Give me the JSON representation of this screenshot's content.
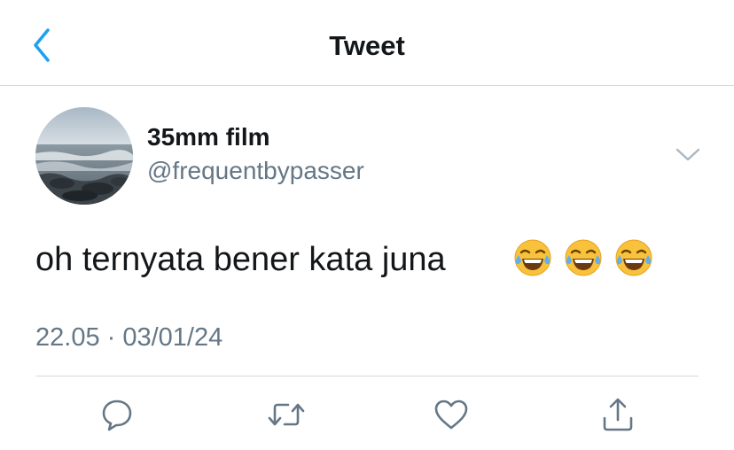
{
  "header": {
    "title": "Tweet",
    "back_icon": "chevron-left-icon",
    "accent_color": "#1da1f2"
  },
  "author": {
    "display_name": "35mm film",
    "handle": "@frequentbypasser",
    "avatar": "beach-photo-avatar"
  },
  "tweet": {
    "text": "oh ternyata bener kata juna",
    "emojis": [
      "😂",
      "😂",
      "😂"
    ],
    "timestamp": "22.05 · 03/01/24"
  },
  "actions": [
    {
      "name": "reply",
      "icon": "speech-bubble-icon"
    },
    {
      "name": "retweet",
      "icon": "retweet-icon"
    },
    {
      "name": "like",
      "icon": "heart-icon"
    },
    {
      "name": "share",
      "icon": "share-icon"
    }
  ],
  "colors": {
    "text_primary": "#14171a",
    "text_secondary": "#657786",
    "divider": "#d6d9dc",
    "icon_gray": "#657786"
  }
}
